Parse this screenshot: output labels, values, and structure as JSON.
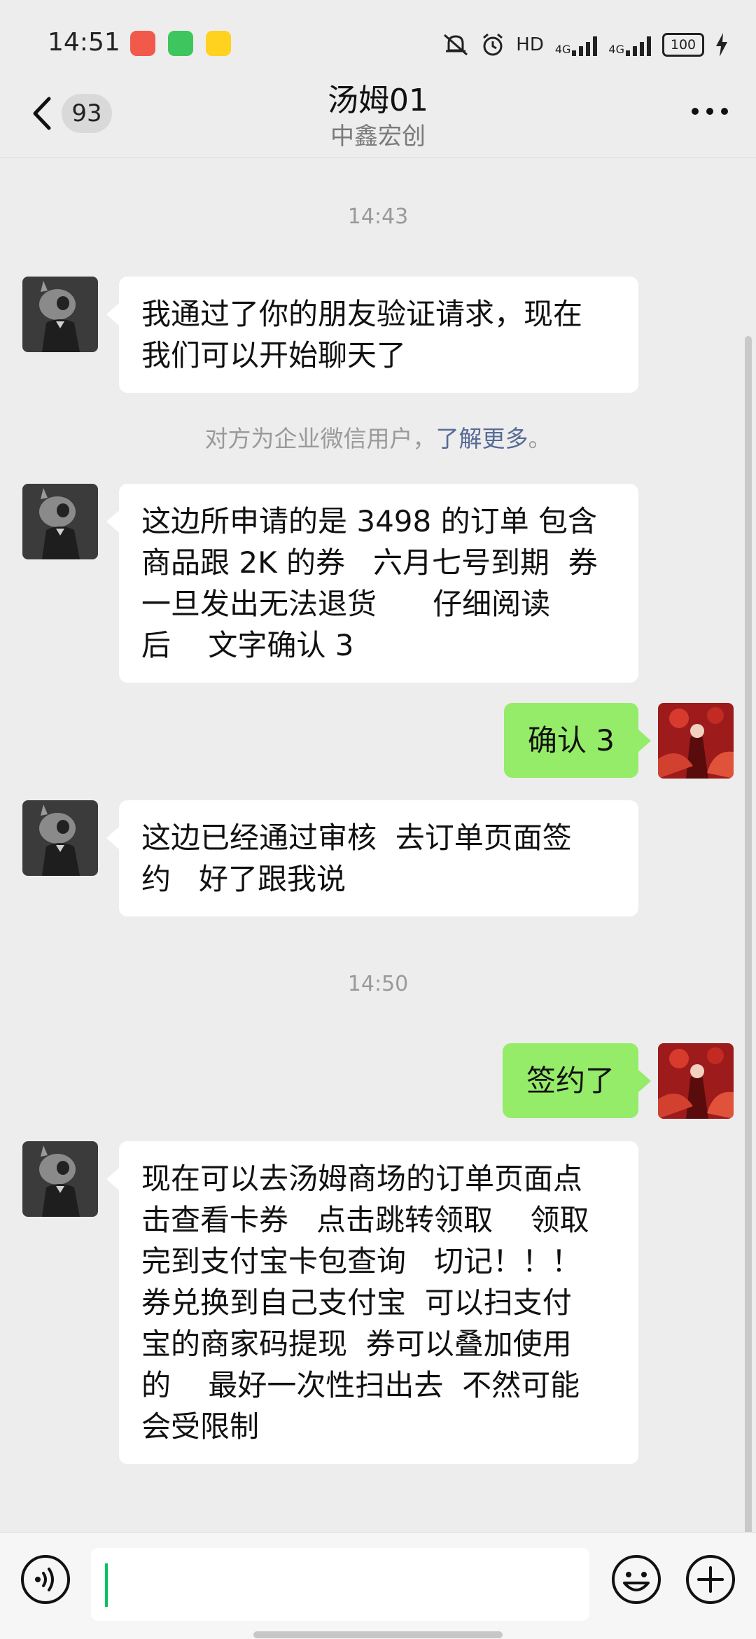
{
  "status_bar": {
    "time": "14:51",
    "network": "HD",
    "signal1": "4G",
    "signal2": "4G",
    "battery": "100"
  },
  "header": {
    "unread_count": "93",
    "title": "汤姆01",
    "subtitle": "中鑫宏创"
  },
  "chat": {
    "time_1": "14:43",
    "msg_1": "我通过了你的朋友验证请求，现在\n我们可以开始聊天了",
    "system_note_text": "对方为企业微信用户，",
    "system_note_link": "了解更多",
    "system_note_end": "。",
    "msg_2": "这边所申请的是 3498 的订单 包含\n商品跟 2K 的券   六月七号到期  券\n一旦发出无法退货      仔细阅读\n后    文字确认 3",
    "msg_3": "确认 3",
    "msg_4": "这边已经通过审核  去订单页面签\n约   好了跟我说",
    "time_2": "14:50",
    "msg_5": "签约了",
    "msg_6": "现在可以去汤姆商场的订单页面点\n击查看卡券   点击跳转领取    领取\n完到支付宝卡包查询   切记！！！\n券兑换到自己支付宝  可以扫支付\n宝的商家码提现  券可以叠加使用\n的    最好一次性扫出去  不然可能\n会受限制"
  },
  "input": {
    "value": ""
  },
  "colors": {
    "background": "#ededed",
    "incoming_bubble": "#ffffff",
    "outgoing_bubble": "#95ec69",
    "link": "#576b95",
    "caret": "#07c160"
  }
}
